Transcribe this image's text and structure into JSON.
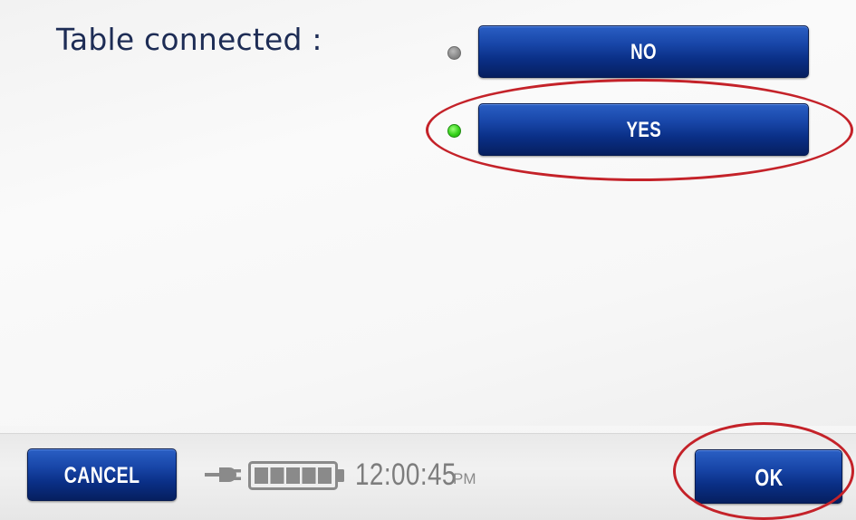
{
  "question": {
    "label": "Table connected :"
  },
  "options": [
    {
      "label": "NO",
      "selected": false
    },
    {
      "label": "YES",
      "selected": true
    }
  ],
  "bottom_bar": {
    "cancel_label": "CANCEL",
    "ok_label": "OK",
    "time": "12:00:45",
    "ampm": "PM",
    "power_icon": "plug-icon",
    "battery_icon": "battery-icon",
    "battery_level": 1.0
  },
  "colors": {
    "button_blue": "#1846a8",
    "highlight_red": "#c42229",
    "radio_selected": "#35d21a",
    "radio_unselected": "#888888",
    "label_navy": "#1d2c55"
  }
}
